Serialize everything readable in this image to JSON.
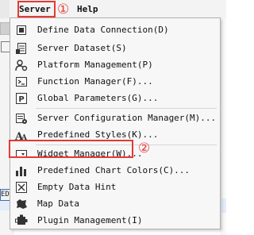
{
  "menubar": {
    "server_label": "Server",
    "help_label": "Help"
  },
  "callouts": {
    "first": "①",
    "second": "②"
  },
  "background": {
    "cell_text": "ED"
  },
  "menu": {
    "items": [
      {
        "label": "Define Data Connection(D)",
        "icon": "data-connection-icon"
      },
      {
        "label": "Server Dataset(S)",
        "icon": "server-dataset-icon"
      },
      {
        "label": "Platform Management(P)",
        "icon": "platform-management-icon"
      },
      {
        "label": "Function Manager(F)...",
        "icon": "function-manager-icon"
      },
      {
        "label": "Global Parameters(G)...",
        "icon": "global-parameters-icon"
      },
      {
        "label": "Server Configuration Manager(M)...",
        "icon": "server-configuration-icon"
      },
      {
        "label": "Predefined Styles(K)...",
        "icon": "predefined-styles-icon"
      },
      {
        "label": "Widget Manager(W)...",
        "icon": "widget-manager-icon"
      },
      {
        "label": "Predefined Chart Colors(C)...",
        "icon": "chart-colors-icon"
      },
      {
        "label": "Empty Data Hint",
        "icon": "empty-data-hint-icon"
      },
      {
        "label": "Map Data",
        "icon": "map-data-icon"
      },
      {
        "label": "Plugin Management(I)",
        "icon": "plugin-management-icon"
      }
    ]
  }
}
